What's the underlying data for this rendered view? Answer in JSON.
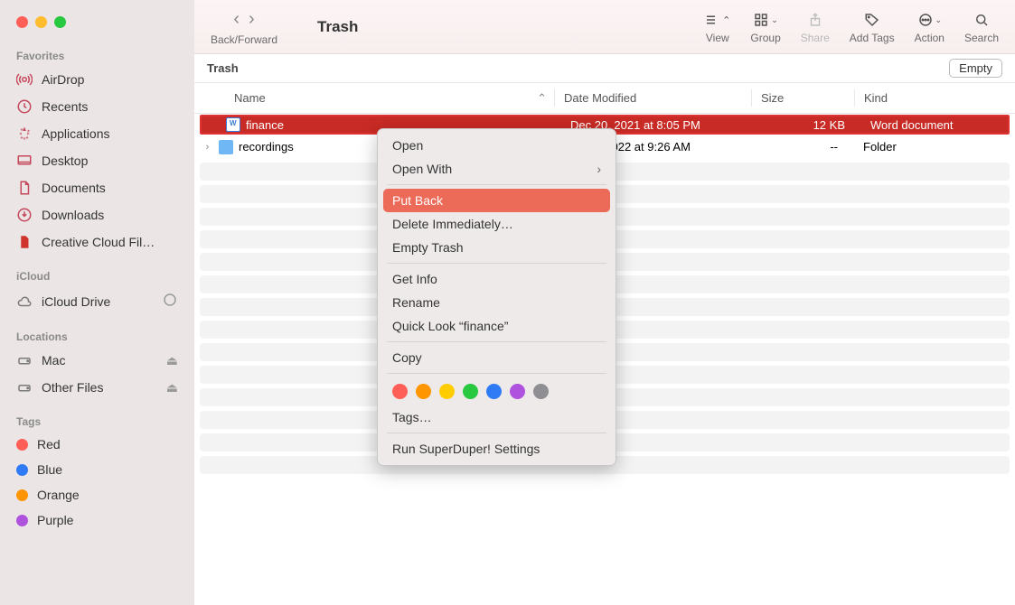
{
  "window": {
    "title": "Trash"
  },
  "toolbar": {
    "back_forward": "Back/Forward",
    "view": "View",
    "group": "Group",
    "share": "Share",
    "add_tags": "Add Tags",
    "action": "Action",
    "search": "Search"
  },
  "pathbar": {
    "location": "Trash",
    "empty_btn": "Empty"
  },
  "columns": {
    "name": "Name",
    "date": "Date Modified",
    "size": "Size",
    "kind": "Kind"
  },
  "sidebar": {
    "favorites_header": "Favorites",
    "favorites": [
      {
        "label": "AirDrop",
        "icon": "airdrop"
      },
      {
        "label": "Recents",
        "icon": "clock"
      },
      {
        "label": "Applications",
        "icon": "apps"
      },
      {
        "label": "Desktop",
        "icon": "desktop"
      },
      {
        "label": "Documents",
        "icon": "doc"
      },
      {
        "label": "Downloads",
        "icon": "download"
      },
      {
        "label": "Creative Cloud Fil…",
        "icon": "cc"
      }
    ],
    "icloud_header": "iCloud",
    "icloud": [
      {
        "label": "iCloud Drive",
        "icon": "cloud",
        "trail": "progress"
      }
    ],
    "locations_header": "Locations",
    "locations": [
      {
        "label": "Mac",
        "icon": "disk",
        "trail": "eject"
      },
      {
        "label": "Other Files",
        "icon": "disk",
        "trail": "eject"
      }
    ],
    "tags_header": "Tags",
    "tags": [
      {
        "label": "Red",
        "color": "#ff5f57"
      },
      {
        "label": "Blue",
        "color": "#2f7bf6"
      },
      {
        "label": "Orange",
        "color": "#ff9500"
      },
      {
        "label": "Purple",
        "color": "#af52de"
      }
    ]
  },
  "files": [
    {
      "name": "finance",
      "date": "Dec 20, 2021 at 8:05 PM",
      "size": "12 KB",
      "kind": "Word document",
      "selected": true,
      "icon": "word"
    },
    {
      "name": "recordings",
      "date": "Jan 26, 2022 at 9:26 AM",
      "size": "--",
      "kind": "Folder",
      "selected": false,
      "icon": "folder",
      "expandable": true
    }
  ],
  "context_menu": {
    "open": "Open",
    "open_with": "Open With",
    "put_back": "Put Back",
    "delete": "Delete Immediately…",
    "empty": "Empty Trash",
    "get_info": "Get Info",
    "rename": "Rename",
    "quick_look": "Quick Look “finance”",
    "copy": "Copy",
    "tags": "Tags…",
    "run": "Run SuperDuper! Settings",
    "tag_colors": [
      "#ff5f57",
      "#ff9500",
      "#ffcc00",
      "#28c840",
      "#2f7bf6",
      "#af52de",
      "#8e8e93"
    ]
  }
}
